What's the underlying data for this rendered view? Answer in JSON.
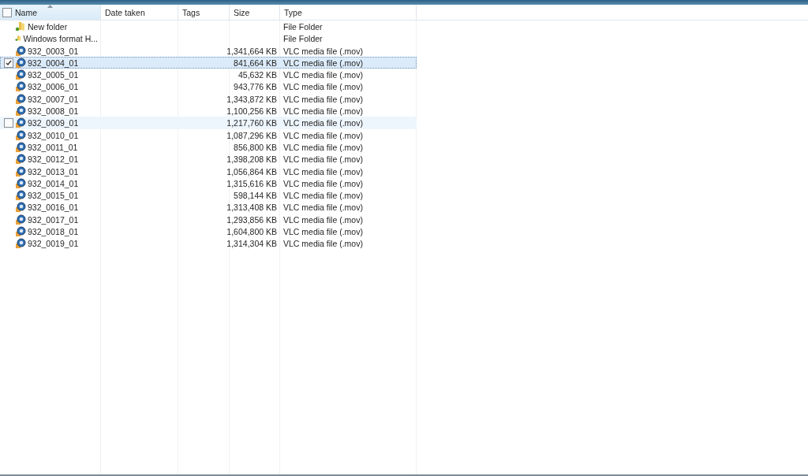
{
  "header": {
    "select_all_checked": false,
    "columns": [
      {
        "label": "Name",
        "sorted": true
      },
      {
        "label": "Date taken",
        "sorted": false
      },
      {
        "label": "Tags",
        "sorted": false
      },
      {
        "label": "Size",
        "sorted": false
      },
      {
        "label": "Type",
        "sorted": false
      }
    ]
  },
  "rows": [
    {
      "kind": "folder",
      "name": "New folder",
      "size": "",
      "type": "File Folder",
      "selected": false,
      "hovered": false,
      "checked": false
    },
    {
      "kind": "folder",
      "name": "Windows format H...",
      "size": "",
      "type": "File Folder",
      "selected": false,
      "hovered": false,
      "checked": false
    },
    {
      "kind": "video",
      "name": "932_0003_01",
      "size": "1,341,664 KB",
      "type": "VLC media file (.mov)",
      "selected": false,
      "hovered": false,
      "checked": false
    },
    {
      "kind": "video",
      "name": "932_0004_01",
      "size": "841,664 KB",
      "type": "VLC media file (.mov)",
      "selected": true,
      "hovered": false,
      "checked": true
    },
    {
      "kind": "video",
      "name": "932_0005_01",
      "size": "45,632 KB",
      "type": "VLC media file (.mov)",
      "selected": false,
      "hovered": false,
      "checked": false
    },
    {
      "kind": "video",
      "name": "932_0006_01",
      "size": "943,776 KB",
      "type": "VLC media file (.mov)",
      "selected": false,
      "hovered": false,
      "checked": false
    },
    {
      "kind": "video",
      "name": "932_0007_01",
      "size": "1,343,872 KB",
      "type": "VLC media file (.mov)",
      "selected": false,
      "hovered": false,
      "checked": false
    },
    {
      "kind": "video",
      "name": "932_0008_01",
      "size": "1,100,256 KB",
      "type": "VLC media file (.mov)",
      "selected": false,
      "hovered": false,
      "checked": false
    },
    {
      "kind": "video",
      "name": "932_0009_01",
      "size": "1,217,760 KB",
      "type": "VLC media file (.mov)",
      "selected": false,
      "hovered": true,
      "checked": false
    },
    {
      "kind": "video",
      "name": "932_0010_01",
      "size": "1,087,296 KB",
      "type": "VLC media file (.mov)",
      "selected": false,
      "hovered": false,
      "checked": false
    },
    {
      "kind": "video",
      "name": "932_0011_01",
      "size": "856,800 KB",
      "type": "VLC media file (.mov)",
      "selected": false,
      "hovered": false,
      "checked": false
    },
    {
      "kind": "video",
      "name": "932_0012_01",
      "size": "1,398,208 KB",
      "type": "VLC media file (.mov)",
      "selected": false,
      "hovered": false,
      "checked": false
    },
    {
      "kind": "video",
      "name": "932_0013_01",
      "size": "1,056,864 KB",
      "type": "VLC media file (.mov)",
      "selected": false,
      "hovered": false,
      "checked": false
    },
    {
      "kind": "video",
      "name": "932_0014_01",
      "size": "1,315,616 KB",
      "type": "VLC media file (.mov)",
      "selected": false,
      "hovered": false,
      "checked": false
    },
    {
      "kind": "video",
      "name": "932_0015_01",
      "size": "598,144 KB",
      "type": "VLC media file (.mov)",
      "selected": false,
      "hovered": false,
      "checked": false
    },
    {
      "kind": "video",
      "name": "932_0016_01",
      "size": "1,313,408 KB",
      "type": "VLC media file (.mov)",
      "selected": false,
      "hovered": false,
      "checked": false
    },
    {
      "kind": "video",
      "name": "932_0017_01",
      "size": "1,293,856 KB",
      "type": "VLC media file (.mov)",
      "selected": false,
      "hovered": false,
      "checked": false
    },
    {
      "kind": "video",
      "name": "932_0018_01",
      "size": "1,604,800 KB",
      "type": "VLC media file (.mov)",
      "selected": false,
      "hovered": false,
      "checked": false
    },
    {
      "kind": "video",
      "name": "932_0019_01",
      "size": "1,314,304 KB",
      "type": "VLC media file (.mov)",
      "selected": false,
      "hovered": false,
      "checked": false
    }
  ]
}
